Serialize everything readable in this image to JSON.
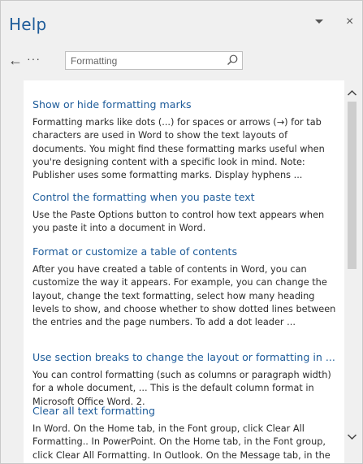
{
  "pane": {
    "title": "Help",
    "close_glyph": "×"
  },
  "nav": {
    "back_glyph": "←",
    "more_glyph": "···"
  },
  "search": {
    "value": "Formatting",
    "placeholder": "Formatting"
  },
  "results": [
    {
      "title": "Show or hide formatting marks",
      "snippet": "Formatting marks like dots (...) for spaces or arrows (→) for tab characters are used in Word to show the text layouts of documents. You might find these formatting marks useful when you're designing content with a specific look in mind. Note: Publisher uses some formatting marks. Display hyphens ..."
    },
    {
      "title": "Control the formatting when you paste text",
      "snippet": "Use the Paste Options button to control how text appears when you paste it into a document in Word."
    },
    {
      "title": "Format or customize a table of contents",
      "snippet": "After you have created a table of contents in Word, you can customize the way it appears. For example, you can change the layout, change the text formatting, select how many heading levels to show, and choose whether to show dotted lines between the entries and the page numbers. To add a dot leader ..."
    },
    {
      "title": "Use section breaks to change the layout or formatting in ...",
      "snippet": "You can control formatting (such as columns or paragraph width) for a whole document, ... This is the default column format in Microsoft Office Word. 2."
    },
    {
      "title": "Clear all text formatting",
      "snippet": "In Word. On the Home tab, in the Font group, click Clear All Formatting.. In PowerPoint. On the Home tab, in the Font group, click Clear All Formatting. In Outlook. On the Message tab, in the"
    }
  ],
  "colors": {
    "accent": "#1e5c9a",
    "pane_background": "#f0f0f0",
    "results_background": "#ffffff"
  },
  "icons": {
    "dropdown": "chevron-down-icon",
    "close": "close-icon",
    "back": "back-arrow-icon",
    "more": "more-icon",
    "search": "search-icon",
    "scroll_up": "chevron-up-icon",
    "scroll_down": "chevron-down-icon"
  }
}
